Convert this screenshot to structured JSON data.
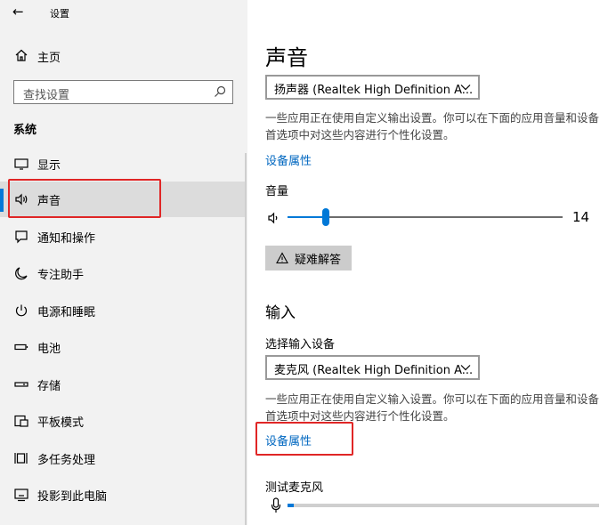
{
  "window": {
    "title": "设置",
    "back_glyph": "←"
  },
  "sidebar": {
    "home_label": "主页",
    "search_placeholder": "查找设置",
    "section_title": "系统",
    "items": [
      {
        "label": "显示",
        "icon": "display-icon"
      },
      {
        "label": "声音",
        "icon": "speaker-icon",
        "active": true
      },
      {
        "label": "通知和操作",
        "icon": "notification-icon"
      },
      {
        "label": "专注助手",
        "icon": "moon-icon"
      },
      {
        "label": "电源和睡眠",
        "icon": "power-icon"
      },
      {
        "label": "电池",
        "icon": "battery-icon"
      },
      {
        "label": "存储",
        "icon": "storage-icon"
      },
      {
        "label": "平板模式",
        "icon": "tablet-icon"
      },
      {
        "label": "多任务处理",
        "icon": "multitask-icon"
      },
      {
        "label": "投影到此电脑",
        "icon": "project-icon"
      }
    ]
  },
  "main": {
    "title": "声音",
    "output": {
      "device": "扬声器 (Realtek High Definition A...",
      "description": "一些应用正在使用自定义输出设置。你可以在下面的应用音量和设备首选项中对这些内容进行个性化设置。",
      "properties_link": "设备属性",
      "volume_label": "音量",
      "volume_value": "14",
      "volume_fraction": 0.14,
      "troubleshoot_label": "疑难解答"
    },
    "input": {
      "section_title": "输入",
      "choose_label": "选择输入设备",
      "device": "麦克风 (Realtek High Definition A...",
      "description": "一些应用正在使用自定义输入设置。你可以在下面的应用音量和设备首选项中对这些内容进行个性化设置。",
      "properties_link": "设备属性",
      "test_label": "测试麦克风",
      "mic_level_fraction": 0.02
    }
  },
  "colors": {
    "accent": "#0078d7",
    "link": "#0067c0",
    "highlight_box": "#e02626"
  }
}
